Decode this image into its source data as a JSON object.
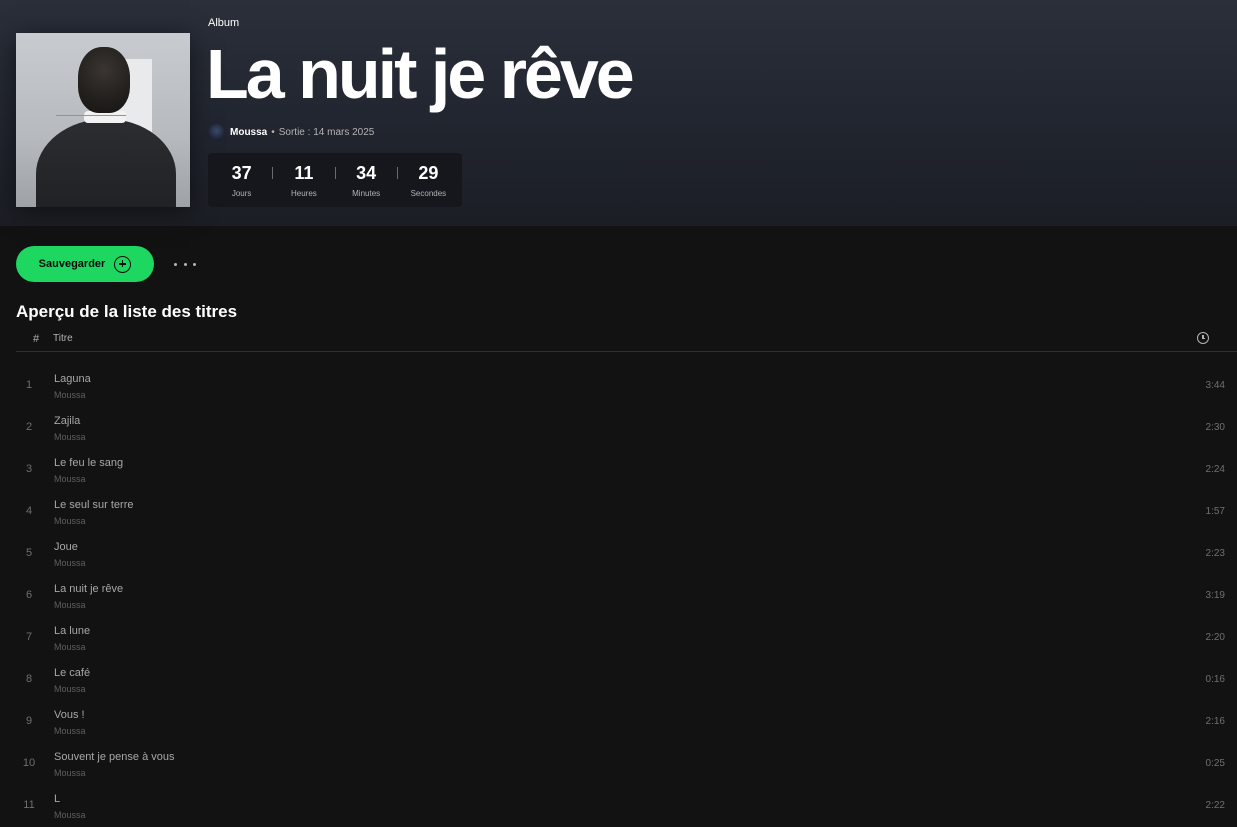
{
  "album": {
    "type_label": "Album",
    "title": "La nuit je rêve",
    "artist": "Moussa",
    "separator": "•",
    "release": "Sortie : 14 mars 2025"
  },
  "countdown": [
    {
      "value": "37",
      "label": "Jours"
    },
    {
      "value": "11",
      "label": "Heures"
    },
    {
      "value": "34",
      "label": "Minutes"
    },
    {
      "value": "29",
      "label": "Secondes"
    }
  ],
  "actions": {
    "save_label": "Sauvegarder",
    "more_icon": "more-options-icon",
    "save_icon": "add-circle-icon"
  },
  "tracklist": {
    "section_title": "Aperçu de la liste des titres",
    "col_number": "#",
    "col_title": "Titre",
    "duration_icon": "clock-icon",
    "tracks": [
      {
        "n": "1",
        "title": "Laguna",
        "artist": "Moussa",
        "duration": "3:44"
      },
      {
        "n": "2",
        "title": "Zajila",
        "artist": "Moussa",
        "duration": "2:30"
      },
      {
        "n": "3",
        "title": "Le feu le sang",
        "artist": "Moussa",
        "duration": "2:24"
      },
      {
        "n": "4",
        "title": "Le seul sur terre",
        "artist": "Moussa",
        "duration": "1:57"
      },
      {
        "n": "5",
        "title": "Joue",
        "artist": "Moussa",
        "duration": "2:23"
      },
      {
        "n": "6",
        "title": "La nuit je rêve",
        "artist": "Moussa",
        "duration": "3:19"
      },
      {
        "n": "7",
        "title": "La lune",
        "artist": "Moussa",
        "duration": "2:20"
      },
      {
        "n": "8",
        "title": "Le café",
        "artist": "Moussa",
        "duration": "0:16"
      },
      {
        "n": "9",
        "title": "Vous !",
        "artist": "Moussa",
        "duration": "2:16"
      },
      {
        "n": "10",
        "title": "Souvent je pense à vous",
        "artist": "Moussa",
        "duration": "0:25"
      },
      {
        "n": "11",
        "title": "L",
        "artist": "Moussa",
        "duration": "2:22"
      }
    ]
  },
  "colors": {
    "accent": "#1ed760",
    "background": "#121212",
    "header": "#2a2f3a"
  }
}
